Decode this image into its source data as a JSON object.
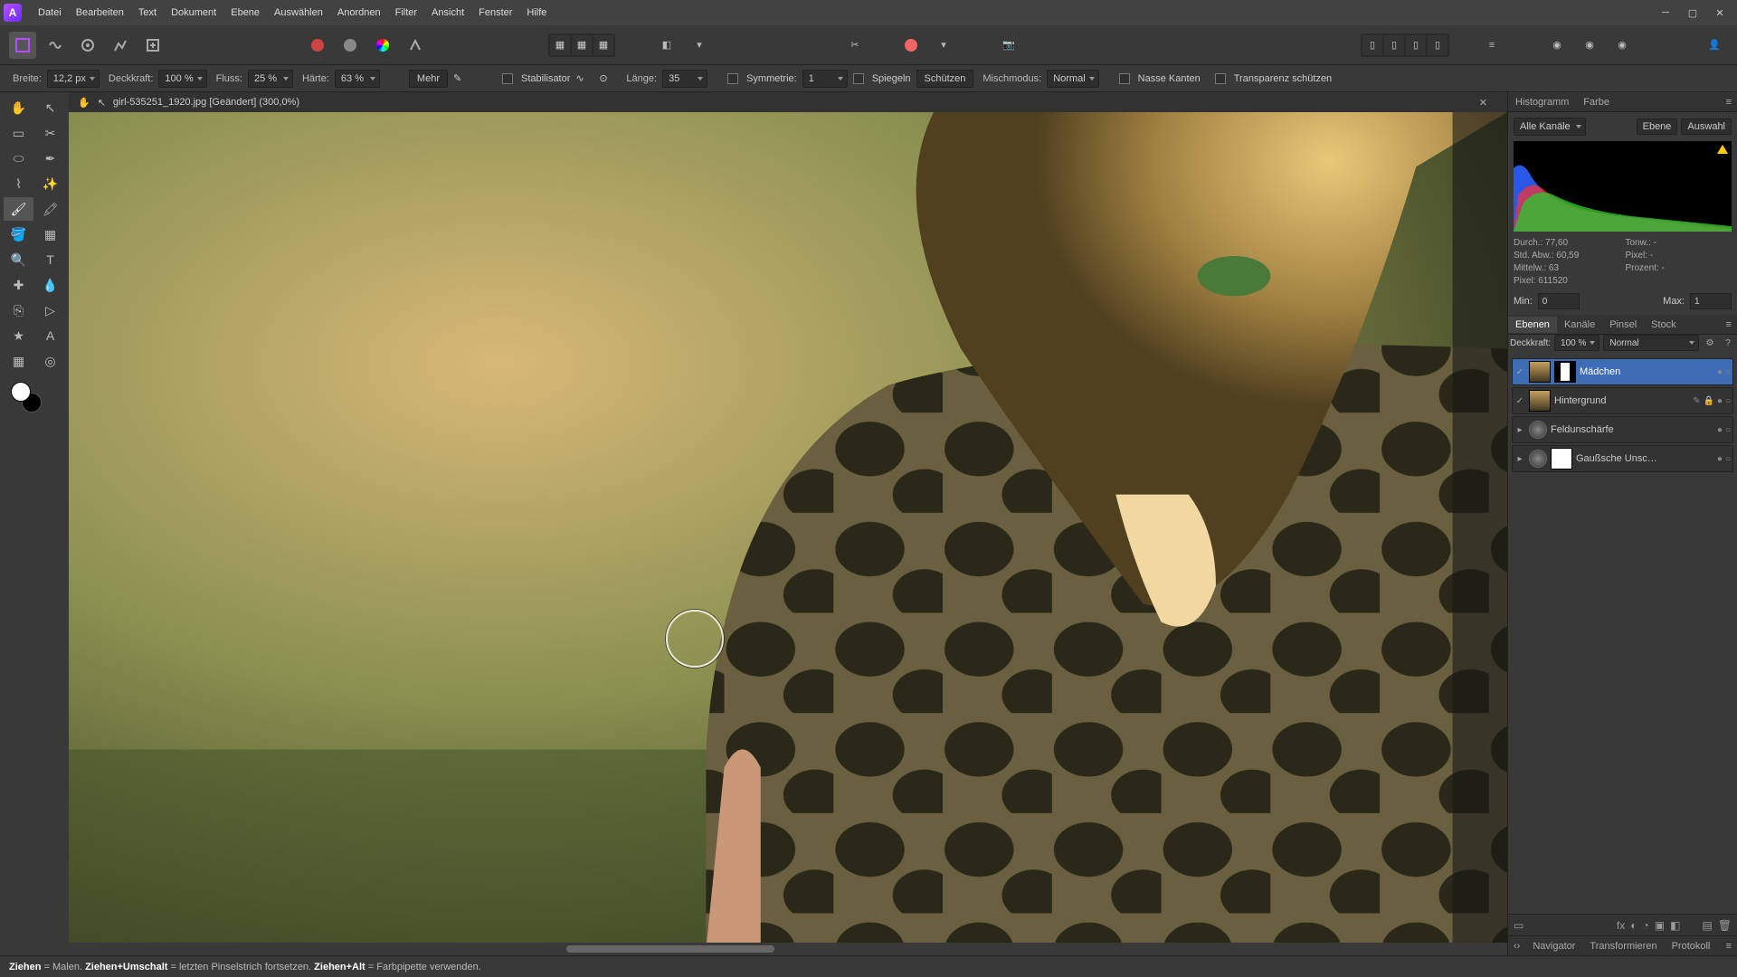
{
  "menu": [
    "Datei",
    "Bearbeiten",
    "Text",
    "Dokument",
    "Ebene",
    "Auswählen",
    "Anordnen",
    "Filter",
    "Ansicht",
    "Fenster",
    "Hilfe"
  ],
  "doc_tab": "girl-535251_1920.jpg [Geändert] (300,0%)",
  "context": {
    "breite_label": "Breite:",
    "breite": "12,2 px",
    "deckkraft_label": "Deckkraft:",
    "deckkraft": "100 %",
    "fluss_label": "Fluss:",
    "fluss": "25 %",
    "haerte_label": "Härte:",
    "haerte": "63 %",
    "mehr": "Mehr",
    "stabilisator": "Stabilisator",
    "laenge_label": "Länge:",
    "laenge": "35",
    "symmetrie_label": "Symmetrie:",
    "symmetrie": "1",
    "spiegeln": "Spiegeln",
    "schuetzen": "Schützen",
    "mischmodus_label": "Mischmodus:",
    "mischmodus": "Normal",
    "nasse": "Nasse Kanten",
    "transparenz": "Transparenz schützen"
  },
  "histogram": {
    "tabs": [
      "Histogramm",
      "Farbe"
    ],
    "channel": "Alle Kanäle",
    "btns": [
      "Ebene",
      "Auswahl"
    ],
    "stats": {
      "durch": "Durch.: 77,60",
      "stdabw": "Std. Abw.: 60,59",
      "mittelw": "Mittelw.: 63",
      "pixel": "Pixel: 611520",
      "tonw": "Tonw.: -",
      "pixel2": "Pixel: -",
      "prozent": "Prozent: -"
    },
    "min_label": "Min:",
    "min": "0",
    "max_label": "Max:",
    "max": "1"
  },
  "layers": {
    "tabs": [
      "Ebenen",
      "Kanäle",
      "Pinsel",
      "Stock"
    ],
    "deckkraft_label": "Deckkraft:",
    "deckkraft": "100 %",
    "blend": "Normal",
    "items": [
      {
        "name": "Mädchen"
      },
      {
        "name": "Hintergrund"
      },
      {
        "name": "Feldunschärfe"
      },
      {
        "name": "Gaußsche Unsc…"
      }
    ]
  },
  "bottom_tabs": [
    "Navigator",
    "Transformieren",
    "Protokoll"
  ],
  "status": {
    "a": "Ziehen",
    "a2": " = Malen. ",
    "b": "Ziehen+Umschalt",
    "b2": " = letzten Pinselstrich fortsetzen. ",
    "c": "Ziehen+Alt",
    "c2": " = Farbpipette verwenden."
  }
}
